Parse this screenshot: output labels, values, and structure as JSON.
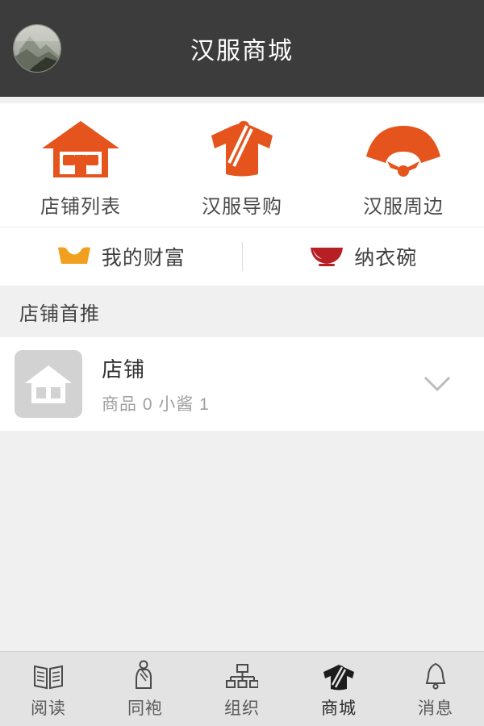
{
  "header": {
    "title": "汉服商城",
    "avatar_alt": "user-avatar-photo"
  },
  "shortcuts": [
    {
      "label": "店铺列表",
      "icon": "house-icon",
      "color": "#e6541d"
    },
    {
      "label": "汉服导购",
      "icon": "hanfu-robe-icon",
      "color": "#e6541d"
    },
    {
      "label": "汉服周边",
      "icon": "folding-fan-icon",
      "color": "#e6541d"
    }
  ],
  "quick_links": [
    {
      "label": "我的财富",
      "icon": "gold-ingot-icon",
      "color": "#f0a01e"
    },
    {
      "label": "纳衣碗",
      "icon": "bowl-icon",
      "color": "#b81f24"
    }
  ],
  "section": {
    "title": "店铺首推"
  },
  "shop_list": [
    {
      "name": "店铺",
      "subtitle": "商品 0    小酱 1",
      "thumb_icon": "house-placeholder-icon",
      "expand_icon": "chevron-down-icon"
    }
  ],
  "bottom_nav": {
    "items": [
      {
        "label": "阅读",
        "icon": "book-icon",
        "active": false
      },
      {
        "label": "同袍",
        "icon": "person-robe-icon",
        "active": false
      },
      {
        "label": "组织",
        "icon": "org-chart-icon",
        "active": false
      },
      {
        "label": "商城",
        "icon": "hanfu-robe-icon",
        "active": true
      },
      {
        "label": "消息",
        "icon": "bell-icon",
        "active": false
      }
    ]
  },
  "colors": {
    "header_bg": "#3c3c3c",
    "page_bg": "#f0f0f0",
    "card_bg": "#ffffff",
    "accent_orange": "#e6541d",
    "accent_gold": "#f0a01e",
    "accent_red": "#b81f24",
    "nav_bg": "#e3e3e3"
  }
}
